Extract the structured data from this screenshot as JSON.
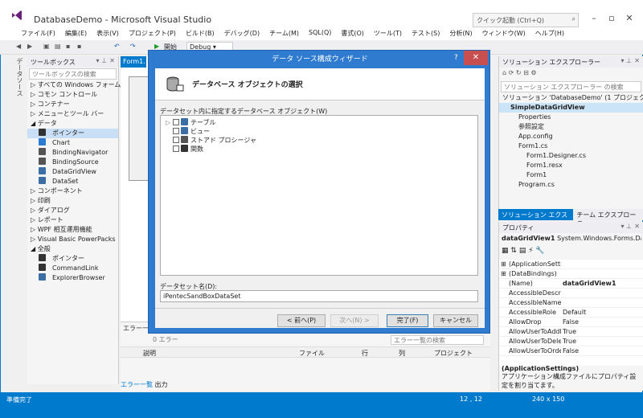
{
  "window": {
    "title": "DatabaseDemo - Microsoft Visual Studio",
    "quick_launch": "クイック起動 (Ctrl+Q)"
  },
  "menu": [
    "ファイル(F)",
    "編集(E)",
    "表示(V)",
    "プロジェクト(P)",
    "ビルド(B)",
    "デバッグ(D)",
    "チーム(M)",
    "SQL(Q)",
    "書式(O)",
    "ツール(T)",
    "テスト(S)",
    "分析(N)",
    "ウィンドウ(W)",
    "ヘルプ(H)"
  ],
  "toolbar": {
    "start": "開始",
    "config": "Debug"
  },
  "side_tab": "データソース",
  "toolbox": {
    "title": "ツールボックス",
    "search_placeholder": "ツールボックスの検索",
    "items": [
      {
        "label": "▷ すべての Windows フォーム",
        "type": "group"
      },
      {
        "label": "▷ コモン コントロール",
        "type": "group"
      },
      {
        "label": "▷ コンテナー",
        "type": "group"
      },
      {
        "label": "▷ メニューとツール バー",
        "type": "group"
      },
      {
        "label": "◢ データ",
        "type": "group"
      },
      {
        "label": "ポインター",
        "type": "item",
        "icon": "pointer-icon",
        "selected": true
      },
      {
        "label": "Chart",
        "type": "item",
        "icon": "chart-icon"
      },
      {
        "label": "BindingNavigator",
        "type": "item",
        "icon": "binding-navigator-icon"
      },
      {
        "label": "BindingSource",
        "type": "item",
        "icon": "binding-source-icon"
      },
      {
        "label": "DataGridView",
        "type": "item",
        "icon": "datagridview-icon"
      },
      {
        "label": "DataSet",
        "type": "item",
        "icon": "dataset-icon"
      },
      {
        "label": "▷ コンポーネント",
        "type": "group"
      },
      {
        "label": "▷ 印刷",
        "type": "group"
      },
      {
        "label": "▷ ダイアログ",
        "type": "group"
      },
      {
        "label": "▷ レポート",
        "type": "group"
      },
      {
        "label": "▷ WPF 相互運用機能",
        "type": "group"
      },
      {
        "label": "▷ Visual Basic PowerPacks",
        "type": "group"
      },
      {
        "label": "◢ 全般",
        "type": "group"
      },
      {
        "label": "ポインター",
        "type": "item",
        "icon": "pointer-icon"
      },
      {
        "label": "CommandLink",
        "type": "item",
        "icon": "commandlink-icon"
      },
      {
        "label": "ExplorerBrowser",
        "type": "item",
        "icon": "explorerbrowser-icon"
      }
    ]
  },
  "editor": {
    "tab": "Form1.",
    "error_list_title": "エラー一覧",
    "error_search": "エラー一覧の検索",
    "error_counts": "0 エラー",
    "columns": [
      "説明",
      "ファイル",
      "行",
      "列",
      "プロジェクト"
    ],
    "bottom_tabs": [
      "エラー一覧",
      "出力"
    ]
  },
  "dialog": {
    "title": "データ ソース構成ウィザード",
    "help": "?",
    "close": "✕",
    "heading": "データベース オブジェクトの選択",
    "objects_label": "データセット内に指定するデータベース オブジェクト(W)",
    "tree": [
      {
        "label": "テーブル",
        "expander": "▷",
        "icon": "table-icon"
      },
      {
        "label": "ビュー",
        "expander": "",
        "icon": "view-icon"
      },
      {
        "label": "ストアド プロシージャ",
        "expander": "",
        "icon": "stored-procedure-icon"
      },
      {
        "label": "関数",
        "expander": "",
        "icon": "function-icon"
      }
    ],
    "dataset_label": "データセット名(D):",
    "dataset_value": "iPentecSandBoxDataSet",
    "buttons": {
      "prev": "< 前へ(P)",
      "next": "次へ(N) >",
      "finish": "完了(F)",
      "cancel": "キャンセル"
    }
  },
  "solution": {
    "title": "ソリューション エクスプローラー",
    "search_placeholder": "ソリューション エクスプローラー の検索",
    "nodes": [
      {
        "label": "ソリューション 'DatabaseDemo' (1 プロジェクト)",
        "indent": 0
      },
      {
        "label": "SimpleDataGridView",
        "indent": 1,
        "bold": true,
        "selected": true
      },
      {
        "label": "Properties",
        "indent": 2
      },
      {
        "label": "参照設定",
        "indent": 2
      },
      {
        "label": "App.config",
        "indent": 2
      },
      {
        "label": "Form1.cs",
        "indent": 2
      },
      {
        "label": "Form1.Designer.cs",
        "indent": 3
      },
      {
        "label": "Form1.resx",
        "indent": 3
      },
      {
        "label": "Form1",
        "indent": 3
      },
      {
        "label": "Program.cs",
        "indent": 2
      }
    ],
    "tabs": [
      "ソリューション エクスプ...",
      "チーム エクスプローラー"
    ]
  },
  "properties": {
    "title": "プロパティ",
    "object_name": "dataGridView1",
    "object_type": "System.Windows.Forms.DataGridView",
    "rows": [
      {
        "name": "(ApplicationSettings)",
        "value": "",
        "expander": "⊞"
      },
      {
        "name": "(DataBindings)",
        "value": "",
        "expander": "⊞"
      },
      {
        "name": "(Name)",
        "value": "dataGridView1",
        "bold": true
      },
      {
        "name": "AccessibleDescription",
        "value": ""
      },
      {
        "name": "AccessibleName",
        "value": ""
      },
      {
        "name": "AccessibleRole",
        "value": "Default"
      },
      {
        "name": "AllowDrop",
        "value": "False"
      },
      {
        "name": "AllowUserToAddRows",
        "value": "True"
      },
      {
        "name": "AllowUserToDeleteRows",
        "value": "True"
      },
      {
        "name": "AllowUserToOrderColumns",
        "value": "False"
      }
    ],
    "desc_title": "(ApplicationSettings)",
    "desc_text": "アプリケーション構成ファイルにプロパティ設定を割り当てます。"
  },
  "status": {
    "left": "準備完了",
    "position": "12 , 12",
    "size": "240 x 150"
  }
}
